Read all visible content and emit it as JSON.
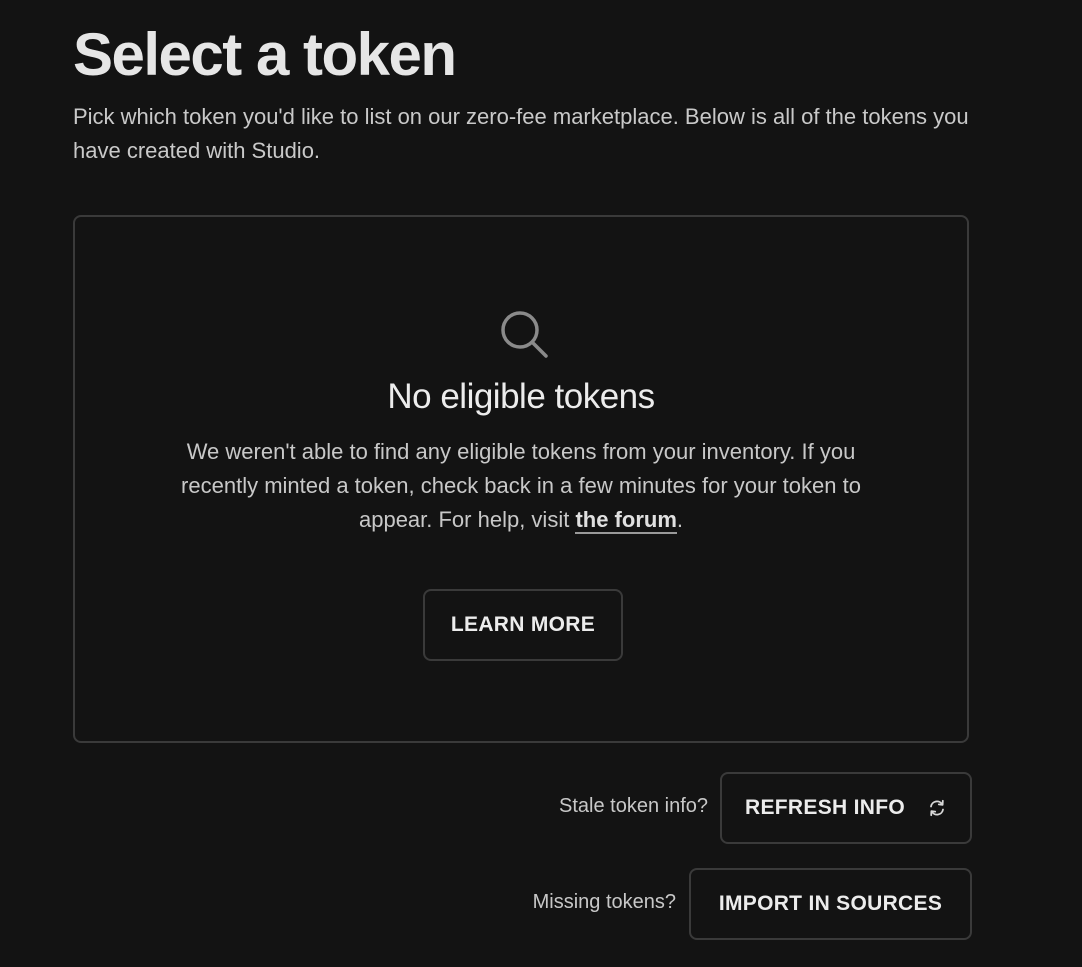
{
  "header": {
    "title": "Select a token",
    "subtitle": "Pick which token you'd like to list on our zero-fee marketplace. Below is all of the tokens you have created with Studio."
  },
  "empty_state": {
    "icon": "search-icon",
    "title": "No eligible tokens",
    "description_before_link": "We weren't able to find any eligible tokens from your inventory. If you recently minted a token, check back in a few minutes for your token to appear. For help, visit ",
    "link_label": "the forum",
    "description_after_link": ".",
    "button_label": "LEARN MORE"
  },
  "actions": {
    "stale_label": "Stale token info?",
    "refresh_label": "REFRESH INFO",
    "refresh_icon": "refresh-icon",
    "missing_label": "Missing tokens?",
    "import_label": "IMPORT IN SOURCES"
  },
  "colors": {
    "background": "#131313",
    "border": "#3a3a3a",
    "text": "#e8e8e8"
  }
}
